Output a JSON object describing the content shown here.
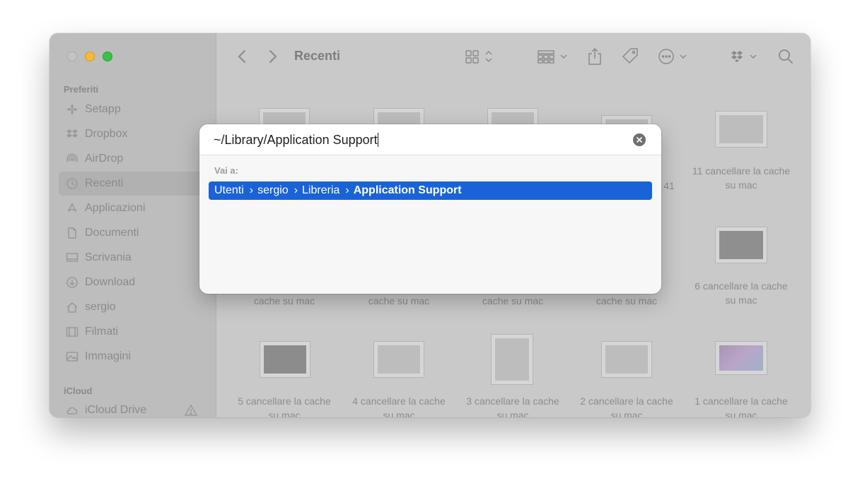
{
  "window": {
    "title": "Recenti"
  },
  "sidebar": {
    "favorites_heading": "Preferiti",
    "items": [
      {
        "label": "Setapp",
        "icon": "setapp-icon",
        "selected": false
      },
      {
        "label": "Dropbox",
        "icon": "dropbox-icon",
        "selected": false
      },
      {
        "label": "AirDrop",
        "icon": "airdrop-icon",
        "selected": false
      },
      {
        "label": "Recenti",
        "icon": "clock-icon",
        "selected": true
      },
      {
        "label": "Applicazioni",
        "icon": "applications-icon",
        "selected": false
      },
      {
        "label": "Documenti",
        "icon": "document-icon",
        "selected": false
      },
      {
        "label": "Scrivania",
        "icon": "desktop-icon",
        "selected": false
      },
      {
        "label": "Download",
        "icon": "download-icon",
        "selected": false
      },
      {
        "label": "sergio",
        "icon": "home-icon",
        "selected": false
      },
      {
        "label": "Filmati",
        "icon": "film-icon",
        "selected": false
      },
      {
        "label": "Immagini",
        "icon": "photo-icon",
        "selected": false
      }
    ],
    "icloud_heading": "iCloud",
    "icloud_item": {
      "label": "iCloud Drive",
      "icon": "cloud-icon",
      "warning_icon": "warning-icon"
    }
  },
  "files": {
    "row1": [
      {
        "caption": "11 cancellare la cache su mac"
      }
    ],
    "row1_partial_caption": "41",
    "row2": [
      {
        "caption": "cache su mac"
      },
      {
        "caption": "cache su mac"
      },
      {
        "caption": "cache su mac"
      },
      {
        "caption": "cache su mac"
      },
      {
        "caption": "6 cancellare la cache su mac"
      }
    ],
    "row3": [
      {
        "caption": "5 cancellare la cache su mac"
      },
      {
        "caption": "4 cancellare la cache su mac"
      },
      {
        "caption": "3 cancellare la cache su mac"
      },
      {
        "caption": "2 cancellare la cache su mac"
      },
      {
        "caption": "1 cancellare la cache su mac"
      }
    ]
  },
  "goto_dialog": {
    "input_value": "~/Library/Application Support",
    "section_label": "Vai a:",
    "result_path": [
      "Utenti",
      "sergio",
      "Libreria",
      "Application Support"
    ]
  },
  "colors": {
    "selection_blue": "#1a62d8",
    "traffic_min": "#f6b93a",
    "traffic_max": "#38c146"
  }
}
